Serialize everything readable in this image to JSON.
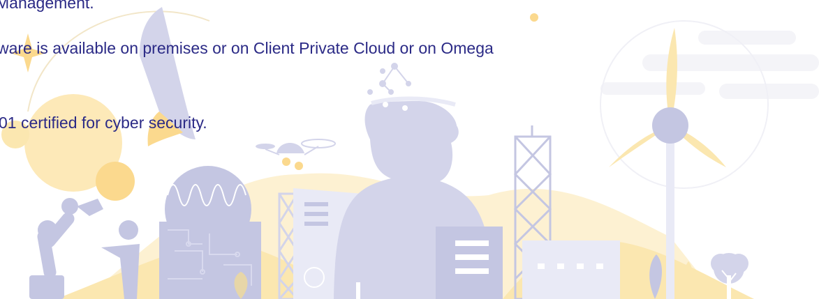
{
  "content": {
    "lines": [
      "Management.",
      "ware is available on premises or on Client Private Cloud or on Omega",
      "01 certified for cyber security."
    ]
  },
  "colors": {
    "text": "#2b2a86",
    "lavender": "#d3d4ea",
    "lavender_dark": "#c4c6e2",
    "lavender_light": "#e9eaf6",
    "yellow": "#fbe7b0",
    "yellow_light": "#fdf1d2",
    "yellow_circle": "#fde9b8",
    "orange_circle": "#fbd98e",
    "grey_light": "#f4f4f8"
  },
  "illustration": {
    "name": "smart-city-line-art"
  }
}
